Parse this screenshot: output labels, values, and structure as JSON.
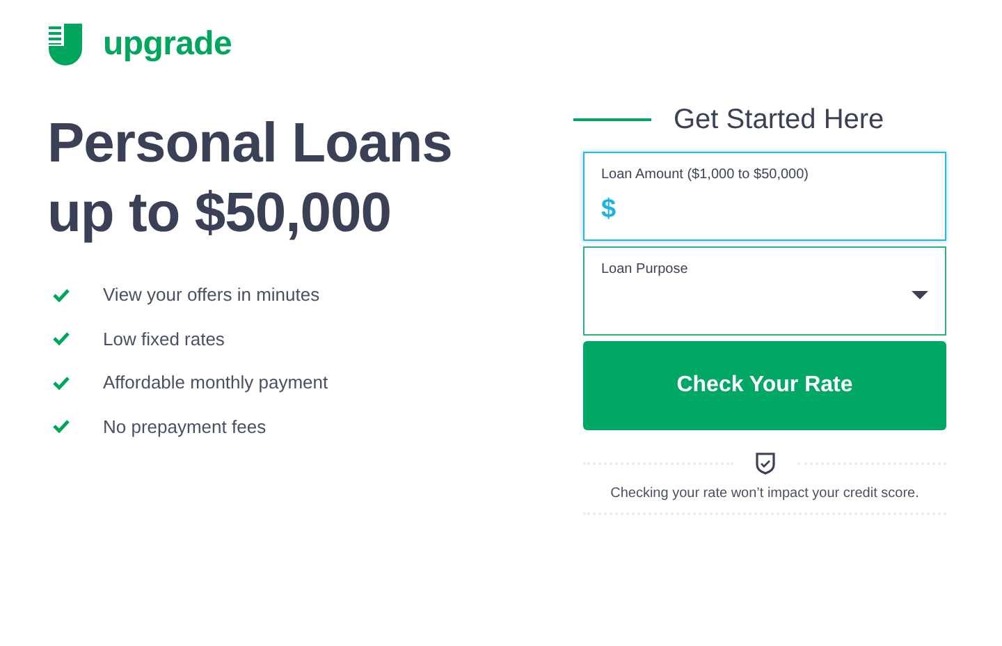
{
  "brand": {
    "name": "upgrade"
  },
  "headline": [
    "Personal Loans",
    "up to $50,000"
  ],
  "benefits": [
    {
      "text": "View your offers in minutes"
    },
    {
      "text": "Low fixed rates"
    },
    {
      "text": "Affordable monthly payment"
    },
    {
      "text": "No prepayment fees"
    }
  ],
  "form": {
    "title": "Get Started Here",
    "fields": [
      {
        "kind": "amount",
        "label": "Loan Amount ($1,000 to $50,000)",
        "prefix": "$",
        "focused": true
      },
      {
        "kind": "select",
        "label": "Loan Purpose",
        "focused": false
      }
    ],
    "submit": "Check Your Rate",
    "note": "Checking your rate won’t impact your credit score."
  }
}
